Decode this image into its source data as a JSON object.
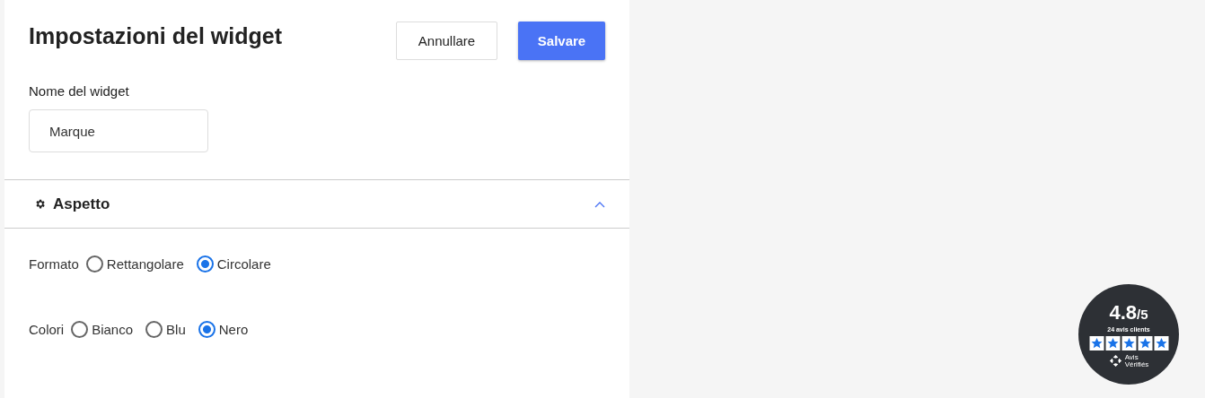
{
  "header": {
    "title": "Impostazioni del widget",
    "buttons": [
      {
        "label": "Annullare",
        "kind": "secondary"
      },
      {
        "label": "Salvare",
        "kind": "primary"
      }
    ]
  },
  "name_field": {
    "label": "Nome del widget",
    "value": "Marque"
  },
  "section": {
    "title": "Aspetto",
    "expanded": true
  },
  "options": [
    {
      "label": "Formato",
      "choices": [
        {
          "label": "Rettangolare",
          "selected": false
        },
        {
          "label": "Circolare",
          "selected": true
        }
      ]
    },
    {
      "label": "Colori",
      "choices": [
        {
          "label": "Bianco",
          "selected": false
        },
        {
          "label": "Blu",
          "selected": false
        },
        {
          "label": "Nero",
          "selected": true
        }
      ]
    }
  ],
  "badge": {
    "rating": "4.8",
    "scale": "/5",
    "count": "24 avis clients",
    "stars": 5,
    "brand": [
      "Avis",
      "Vérifiés"
    ]
  }
}
